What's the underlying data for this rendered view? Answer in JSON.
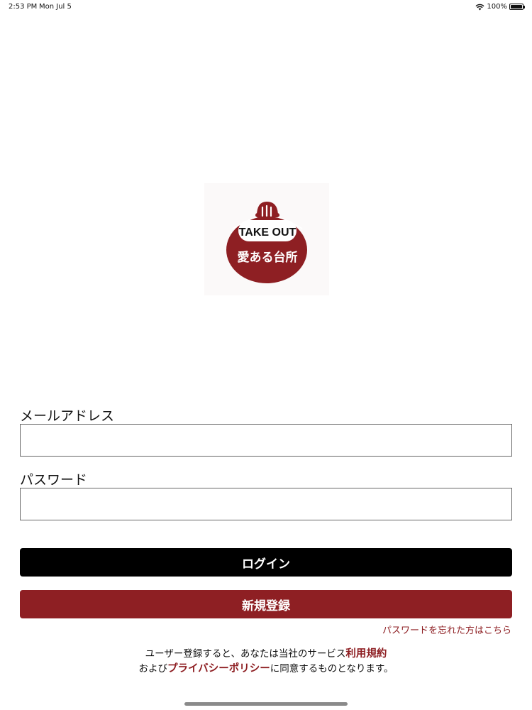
{
  "status_bar": {
    "time": "2:53 PM",
    "date": "Mon Jul 5",
    "battery_text": "100%",
    "battery_level": 1.0
  },
  "logo": {
    "line1": "TAKE OUT",
    "line2": "愛ある台所",
    "brand_color": "#8e1f23"
  },
  "form": {
    "email_label": "メールアドレス",
    "email_value": "",
    "password_label": "パスワード",
    "password_value": ""
  },
  "buttons": {
    "login_label": "ログイン",
    "register_label": "新規登録"
  },
  "links": {
    "forgot_password": "パスワードを忘れた方はこちら"
  },
  "terms": {
    "line1_prefix": "ユーザー登録すると、あなたは当社のサービス",
    "terms_link": "利用規約",
    "line2_prefix": "および",
    "privacy_link": "プライバシーポリシー",
    "line2_suffix": "に同意するものとなります。"
  },
  "colors": {
    "accent": "#8e1f23",
    "login_button": "#000000",
    "background": "#ffffff"
  }
}
